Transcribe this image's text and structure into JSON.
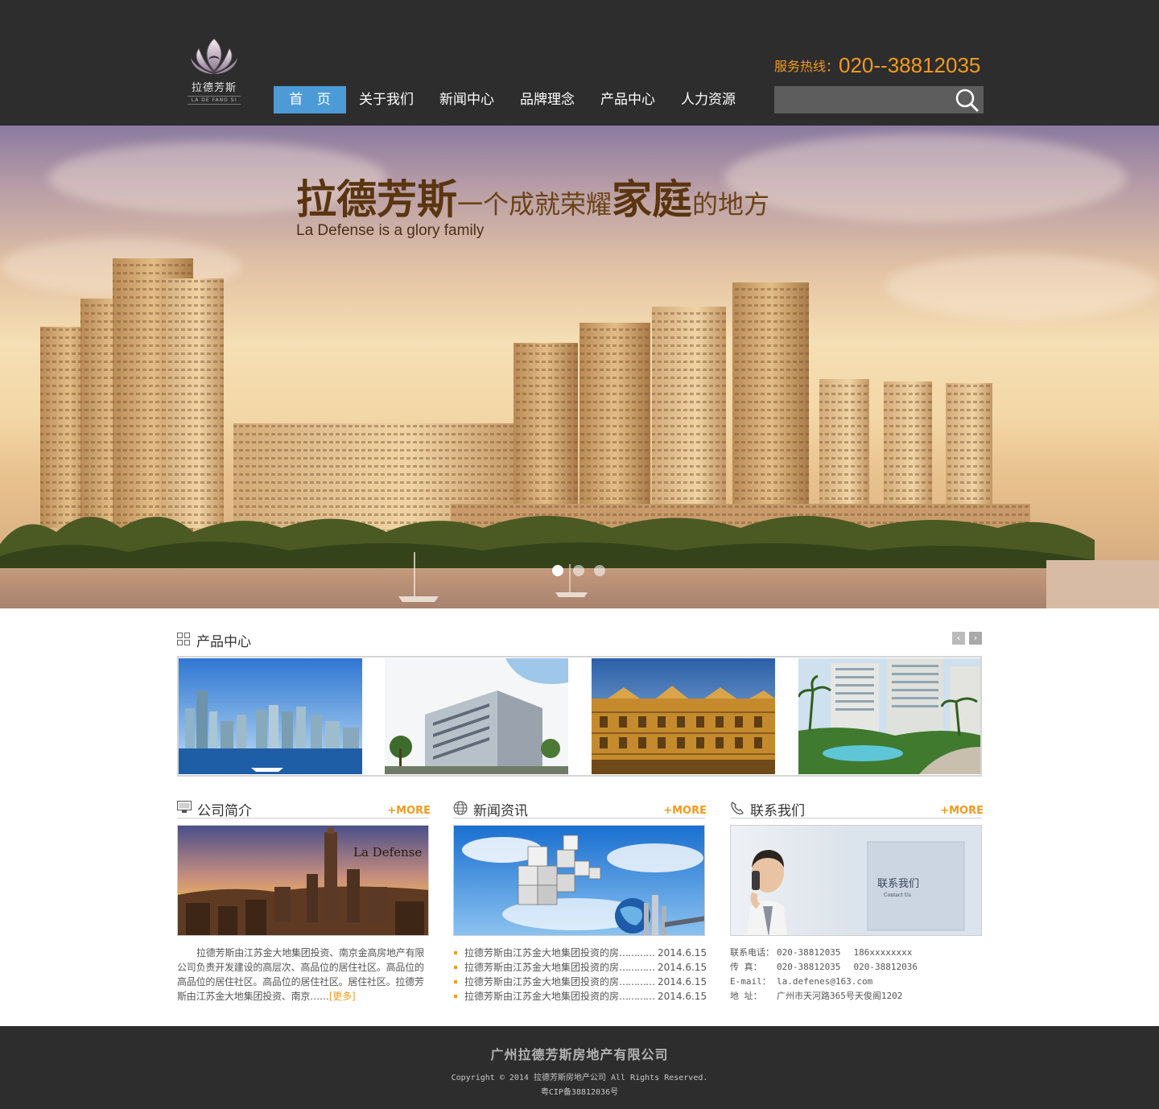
{
  "header": {
    "logo_cn": "拉德芳斯",
    "logo_en": "LA DE FANG SI",
    "hotline_label": "服务热线：",
    "hotline_number": "020--38812035",
    "search_placeholder": ""
  },
  "nav": [
    {
      "label": "首 页"
    },
    {
      "label": "关于我们"
    },
    {
      "label": "新闻中心"
    },
    {
      "label": "品牌理念"
    },
    {
      "label": "产品中心"
    },
    {
      "label": "人力资源"
    }
  ],
  "banner": {
    "title_a": "拉德芳斯",
    "title_b": "一个成就荣耀",
    "title_c": "家庭",
    "title_d": "的地方",
    "subtitle": "La Defense is a glory family",
    "slides": 3,
    "active_slide": 1
  },
  "products": {
    "title": "产品中心",
    "prev": "‹",
    "next": "›"
  },
  "about": {
    "title": "公司简介",
    "more": "+MORE",
    "image_caption": "La Defense",
    "text": "拉德芳斯由江苏金大地集团投资、南京金高房地产有限公司负责开发建设的高层次、高品位的居住社区。高品位的高品位的居住社区。高品位的居住社区。居住社区。拉德芳斯由江苏金大地集团投资、南京……",
    "more_link": "[更多]"
  },
  "news": {
    "title": "新闻资讯",
    "more": "+MORE",
    "items": [
      {
        "title": "拉德芳斯由江苏金大地集团投资的房",
        "dots": "…………",
        "date": "2014.6.15"
      },
      {
        "title": "拉德芳斯由江苏金大地集团投资的房",
        "dots": "…………",
        "date": "2014.6.15"
      },
      {
        "title": "拉德芳斯由江苏金大地集团投资的房",
        "dots": "…………",
        "date": "2014.6.15"
      },
      {
        "title": "拉德芳斯由江苏金大地集团投资的房",
        "dots": "…………",
        "date": "2014.6.15"
      }
    ]
  },
  "contact": {
    "title": "联系我们",
    "more": "+MORE",
    "image_text": "联系我们",
    "image_text_en": "Contact Us",
    "phone_label": "联系电话：",
    "phone": "020-38812035",
    "mobile": "186xxxxxxxx",
    "fax_label": "传    真：",
    "fax1": "020-38812035",
    "fax2": "020-38812036",
    "email_label": "E-mail：",
    "email": "la.defenes@163.com",
    "address_label": "地    址：",
    "address": "广州市天河路365号天俊阁1202"
  },
  "footer": {
    "company": "广州拉德芳斯房地产有限公司",
    "copyright": "Copyright © 2014 拉德芳斯房地产公司 All Rights Reserved.",
    "icp": "粤CIP备38812036号"
  },
  "colors": {
    "header_bg": "#2d2d2d",
    "nav_active": "#4d9bd6",
    "accent_orange": "#f39a1f",
    "footer_bg": "#2d2d2d"
  }
}
